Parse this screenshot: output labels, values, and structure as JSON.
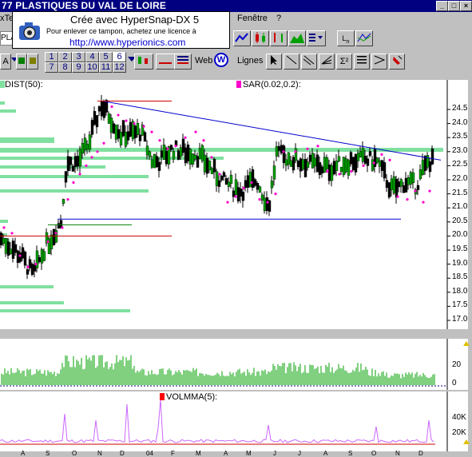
{
  "window": {
    "title": "77 PLASTIQUES DU VAL DE LOIRE",
    "menu_fenetre": "Fenêtre",
    "menu_help": "?",
    "menu_left": "xTe",
    "left_field": "PLA"
  },
  "stamp": {
    "line1": "Crée avec HyperSnap-DX 5",
    "line2": "Pour enlever ce tampon, achetez une licence à",
    "line3": "http://www.hyperionics.com"
  },
  "toolbar2": {
    "a_button": "A",
    "numbers_row1": [
      "1",
      "2",
      "3",
      "4",
      "5",
      "6"
    ],
    "numbers_row2": [
      "7",
      "8",
      "9",
      "10",
      "11",
      "12"
    ],
    "web_label": "Web",
    "lignes_label": "Lignes"
  },
  "main_chart": {
    "indicator1": "DIST(50):",
    "indicator2": "SAR(0.02,0.2):",
    "y_ticks": [
      "24.5",
      "24.0",
      "23.5",
      "23.0",
      "22.5",
      "22.0",
      "21.5",
      "21.0",
      "20.5",
      "20.0",
      "19.5",
      "19.0",
      "18.5",
      "18.0",
      "17.5",
      "17.0"
    ],
    "colors": {
      "up": "#00a000",
      "down": "#000000",
      "sar": "#ff00cc",
      "trend": "#0000cc",
      "level": "#cc0000",
      "dist": "#80e0a0"
    }
  },
  "volume_panel": {
    "y_ticks": [
      "20",
      "0"
    ],
    "color": "#00a000"
  },
  "volmma_panel": {
    "label": "VOLMMA(5):",
    "y_ticks": [
      "40K",
      "20K"
    ],
    "color": "#cc66ff"
  },
  "x_axis": {
    "labels": [
      "A",
      "S",
      "O",
      "N",
      "D",
      "04",
      "F",
      "M",
      "A",
      "M",
      "J",
      "J",
      "A",
      "S",
      "O",
      "N",
      "D"
    ]
  }
}
